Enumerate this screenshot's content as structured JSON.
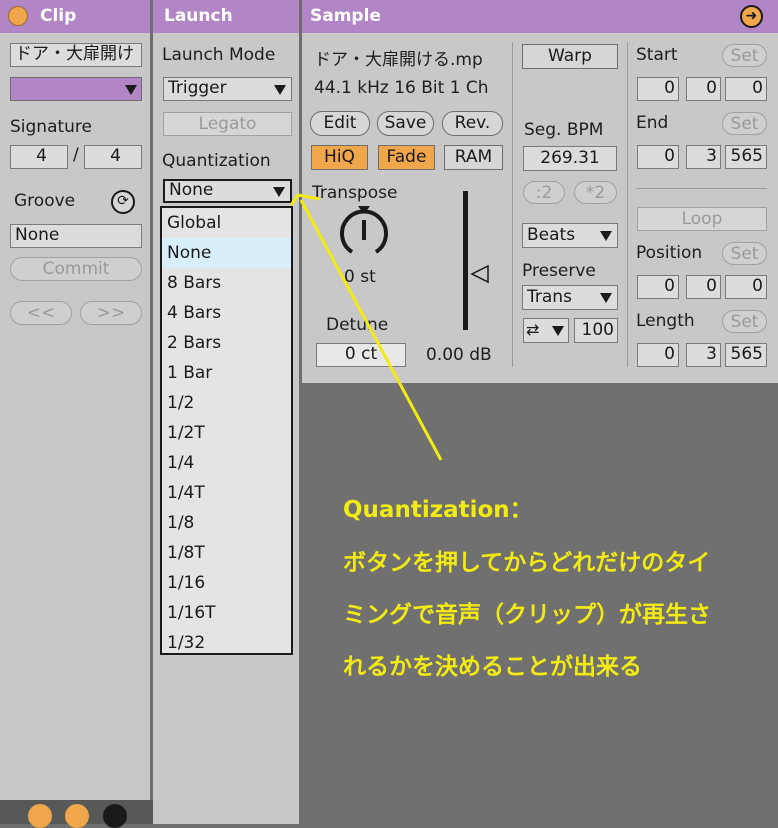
{
  "clip_panel": {
    "title": "Clip",
    "name_value": "ドア・大扉開け",
    "signature_label": "Signature",
    "signature_num": "4",
    "signature_sep": "/",
    "signature_den": "4",
    "groove_label": "Groove",
    "groove_value": "None",
    "commit_label": "Commit",
    "prev_label": "<<",
    "next_label": ">>"
  },
  "launch_panel": {
    "title": "Launch",
    "launch_mode_label": "Launch Mode",
    "launch_mode_value": "Trigger",
    "legato_label": "Legato",
    "quantization_label": "Quantization",
    "quantization_value": "None",
    "menu_items": [
      "Global",
      "None",
      "8 Bars",
      "4 Bars",
      "2 Bars",
      "1 Bar",
      "1/2",
      "1/2T",
      "1/4",
      "1/4T",
      "1/8",
      "1/8T",
      "1/16",
      "1/16T",
      "1/32"
    ],
    "menu_selected": "None"
  },
  "sample_panel": {
    "title": "Sample",
    "file_name": "ドア・大扉開ける.mp",
    "file_info": "44.1 kHz 16 Bit 1 Ch",
    "edit_label": "Edit",
    "save_label": "Save",
    "rev_label": "Rev.",
    "hiq_label": "HiQ",
    "fade_label": "Fade",
    "ram_label": "RAM",
    "transpose_label": "Transpose",
    "transpose_value": "0 st",
    "detune_label": "Detune",
    "detune_value": "0 ct",
    "gain_value": "0.00 dB",
    "warp_label": "Warp",
    "seg_bpm_label": "Seg. BPM",
    "seg_bpm_value": "269.31",
    "half_label": ":2",
    "double_label": "*2",
    "warp_mode_value": "Beats",
    "preserve_label": "Preserve",
    "preserve_value": "Trans",
    "envelope_value": "100",
    "start_label": "Start",
    "start_values": [
      "0",
      "0",
      "0"
    ],
    "end_label": "End",
    "end_values": [
      "0",
      "3",
      "565"
    ],
    "set_label": "Set",
    "loop_label": "Loop",
    "position_label": "Position",
    "position_values": [
      "0",
      "0",
      "0"
    ],
    "length_label": "Length",
    "length_values": [
      "0",
      "3",
      "565"
    ]
  },
  "annotation": {
    "title": "Quantization：",
    "line1": "ボタンを押してからどれだけのタイ",
    "line2": "ミングで音声（クリップ）が再生さ",
    "line3": "れるかを決めることが出来る"
  },
  "colors": {
    "title_bar": "#b286c6",
    "clip_color": "#b286c6",
    "active_button": "#f0a64a",
    "annotation_text": "#f3ea13",
    "menu_selected": "#d8eef8"
  }
}
